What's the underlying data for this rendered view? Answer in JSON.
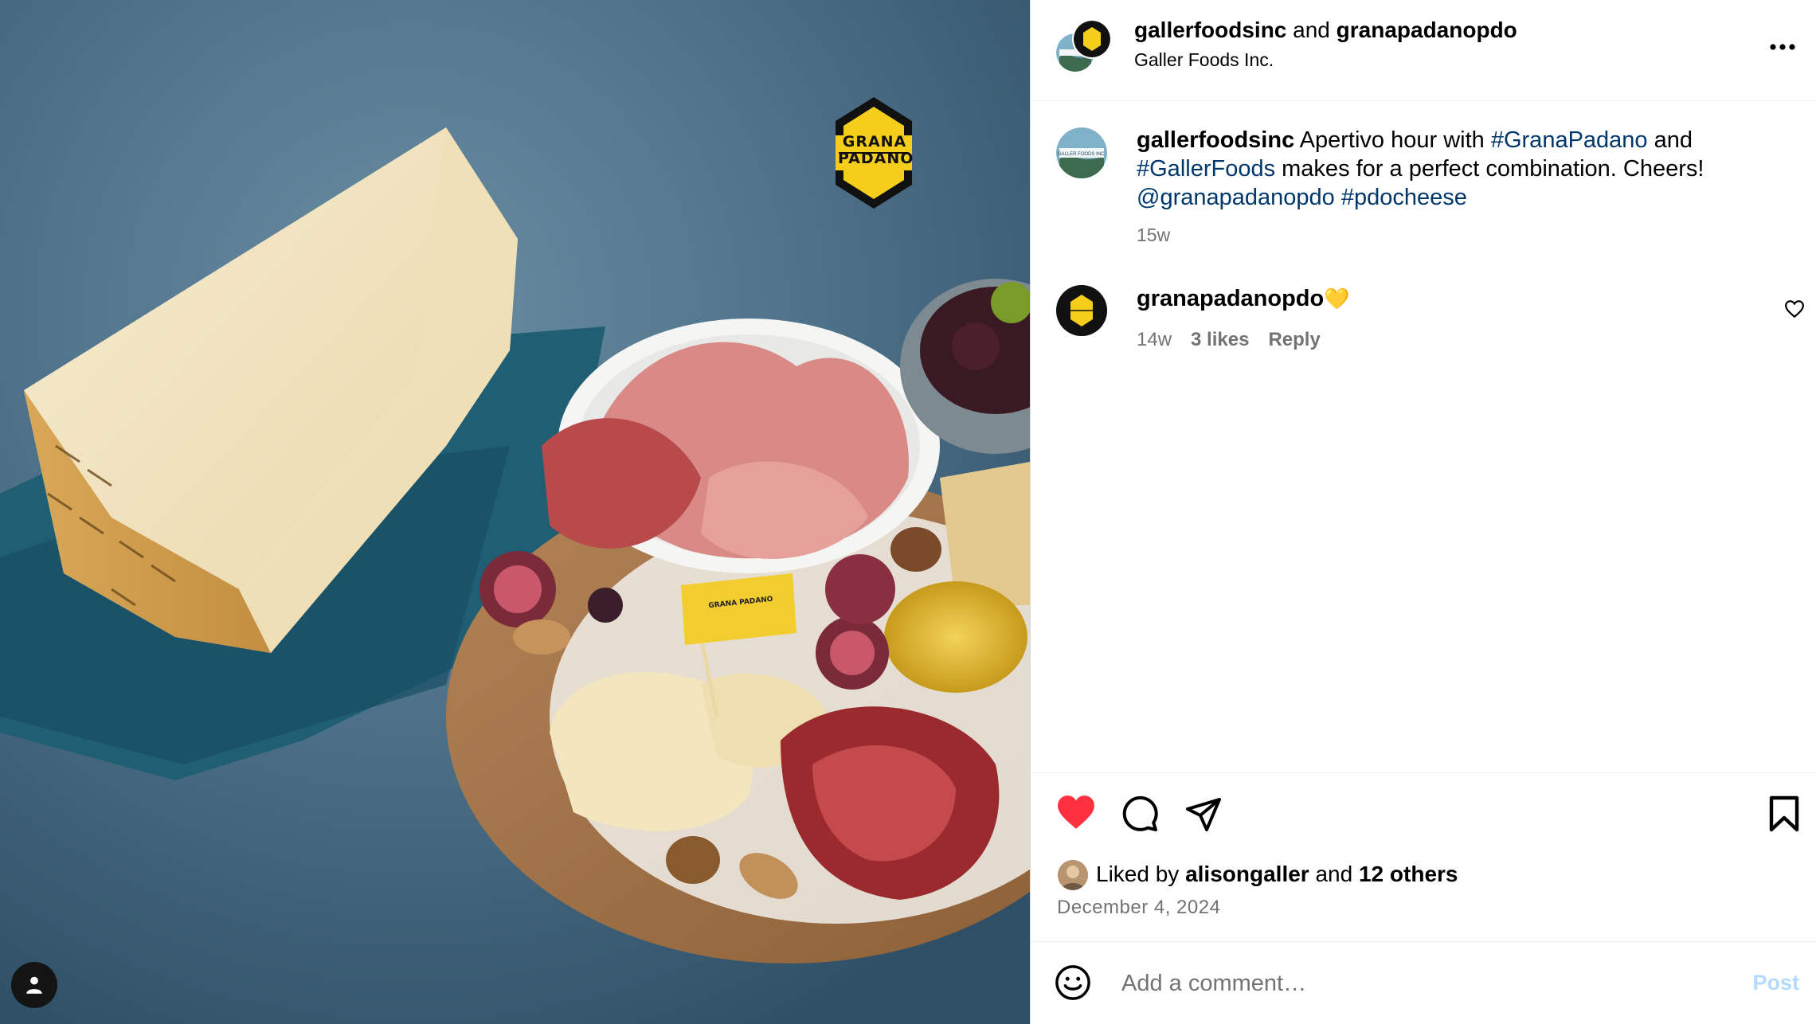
{
  "post": {
    "header": {
      "user1": "gallerfoodsinc",
      "joiner": " and ",
      "user2": "granapadanopdo",
      "subtitle": "Galler Foods Inc.",
      "more": "..."
    },
    "caption": {
      "username": "gallerfoodsinc",
      "text1": " Apertivo hour with ",
      "tag1": "#GranaPadano",
      "text2": " and ",
      "tag2": "#GallerFoods",
      "text3": " makes for a perfect combination. Cheers! ",
      "mention": "@granapadanopdo",
      "tag3": "#pdocheese",
      "time": "15w"
    },
    "comment": {
      "username": "granapadanopdo",
      "emoji": "💛",
      "time": "14w",
      "likes": "3 likes",
      "reply": "Reply"
    },
    "likes": {
      "prefix": "Liked by ",
      "user": "alisongaller",
      "joiner": " and ",
      "others": "12 others"
    },
    "date": "December 4, 2024",
    "comment_box": {
      "placeholder": "Add a comment…",
      "post_label": "Post"
    },
    "image": {
      "logo_line1": "GRANA",
      "logo_line2": "PADANO",
      "flag_text": "GRANA PADANO"
    },
    "avatar_text": "GALLER FOODS INC."
  },
  "colors": {
    "heart": "#ff3040",
    "link": "#00376b",
    "muted": "#737373",
    "post_disabled": "#b3dbff"
  },
  "icons": [
    "heart-icon",
    "comment-icon",
    "share-icon",
    "bookmark-icon",
    "emoji-icon",
    "user-tag-icon",
    "more-icon",
    "comment-like-icon"
  ]
}
